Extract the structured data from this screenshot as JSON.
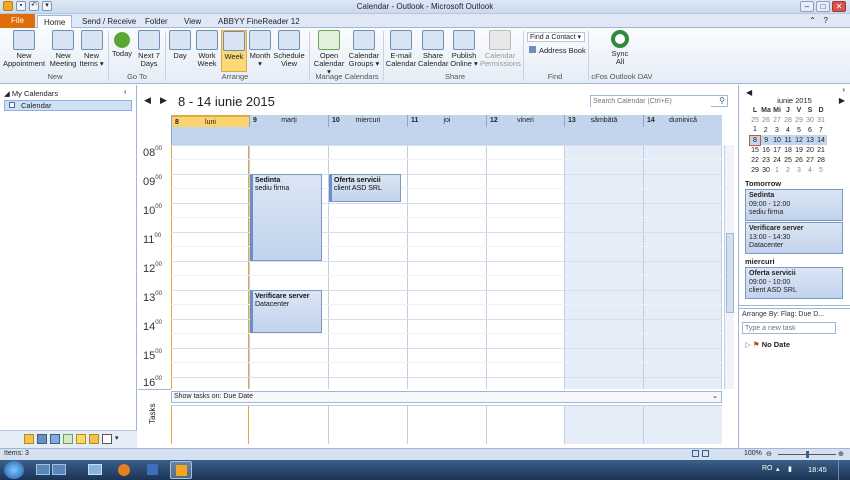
{
  "window": {
    "title": "Calendar - Outlook - Microsoft Outlook"
  },
  "tabs": [
    "File",
    "Home",
    "Send / Receive",
    "Folder",
    "View",
    "ABBYY FineReader 12"
  ],
  "ribbon": {
    "buttons": [
      {
        "l1": "New",
        "l2": "Appointment"
      },
      {
        "l1": "New",
        "l2": "Meeting"
      },
      {
        "l1": "New",
        "l2": "Items ▾"
      },
      {
        "l1": "Today",
        "l2": ""
      },
      {
        "l1": "Next 7",
        "l2": "Days"
      },
      {
        "l1": "Day",
        "l2": ""
      },
      {
        "l1": "Work",
        "l2": "Week"
      },
      {
        "l1": "Week",
        "l2": ""
      },
      {
        "l1": "Month",
        "l2": "▾"
      },
      {
        "l1": "Schedule",
        "l2": "View"
      },
      {
        "l1": "Open",
        "l2": "Calendar ▾"
      },
      {
        "l1": "Calendar",
        "l2": "Groups ▾"
      },
      {
        "l1": "E-mail",
        "l2": "Calendar"
      },
      {
        "l1": "Share",
        "l2": "Calendar"
      },
      {
        "l1": "Publish",
        "l2": "Online ▾"
      },
      {
        "l1": "Calendar",
        "l2": "Permissions"
      },
      {
        "l1": "Sync",
        "l2": "All"
      }
    ],
    "find_contact": "Find a Contact ▾",
    "address_book": "Address Book",
    "groups": [
      "New",
      "Go To",
      "Arrange",
      "Manage Calendars",
      "Share",
      "Find",
      "cFos Outlook DAV"
    ]
  },
  "left": {
    "my_calendars": "My Calendars",
    "calendar": "Calendar"
  },
  "main": {
    "date_range": "8 - 14 iunie 2015",
    "search_placeholder": "Search Calendar (Ctrl+E)",
    "days": [
      {
        "num": "8",
        "name": "luni"
      },
      {
        "num": "9",
        "name": "marți"
      },
      {
        "num": "10",
        "name": "miercuri"
      },
      {
        "num": "11",
        "name": "joi"
      },
      {
        "num": "12",
        "name": "vineri"
      },
      {
        "num": "13",
        "name": "sâmbătă"
      },
      {
        "num": "14",
        "name": "duminică"
      }
    ],
    "hours": [
      "08",
      "09",
      "10",
      "11",
      "12",
      "13",
      "14",
      "15",
      "16"
    ],
    "hour_suffix": "00",
    "appointments": [
      {
        "title": "Sedinta",
        "location": "sediu firma"
      },
      {
        "title": "Oferta servicii",
        "location": "client ASD SRL"
      },
      {
        "title": "Verificare server",
        "location": "Datacenter"
      }
    ],
    "tasks_label": "Tasks",
    "show_tasks": "Show tasks on: Due Date"
  },
  "right": {
    "month_title": "iunie 2015",
    "weekdays": [
      "L",
      "Ma",
      "Mi",
      "J",
      "V",
      "S",
      "D"
    ],
    "weeks": [
      [
        "25",
        "26",
        "27",
        "28",
        "29",
        "30",
        "31"
      ],
      [
        "1",
        "2",
        "3",
        "4",
        "5",
        "6",
        "7"
      ],
      [
        "8",
        "9",
        "10",
        "11",
        "12",
        "13",
        "14"
      ],
      [
        "15",
        "16",
        "17",
        "18",
        "19",
        "20",
        "21"
      ],
      [
        "22",
        "23",
        "24",
        "25",
        "26",
        "27",
        "28"
      ],
      [
        "29",
        "30",
        "1",
        "2",
        "3",
        "4",
        "5"
      ]
    ],
    "tomorrow": "Tomorrow",
    "peek1": {
      "title": "Sedinta",
      "time": "09:00 - 12:00",
      "loc": "sediu firma"
    },
    "peek2": {
      "title": "Verificare server",
      "time": "13:00 - 14:30",
      "loc": "Datacenter"
    },
    "wednesday": "miercuri",
    "peek3": {
      "title": "Oferta servicii",
      "time": "09:00 - 10:00",
      "loc": "client ASD SRL"
    },
    "arrange_by": "Arrange By: Flag: Due D...",
    "new_task_placeholder": "Type a new task",
    "no_date": "No Date"
  },
  "status": {
    "items": "Items: 3",
    "zoom": "100%"
  },
  "taskbar": {
    "lang": "RO",
    "time": "18:45"
  }
}
